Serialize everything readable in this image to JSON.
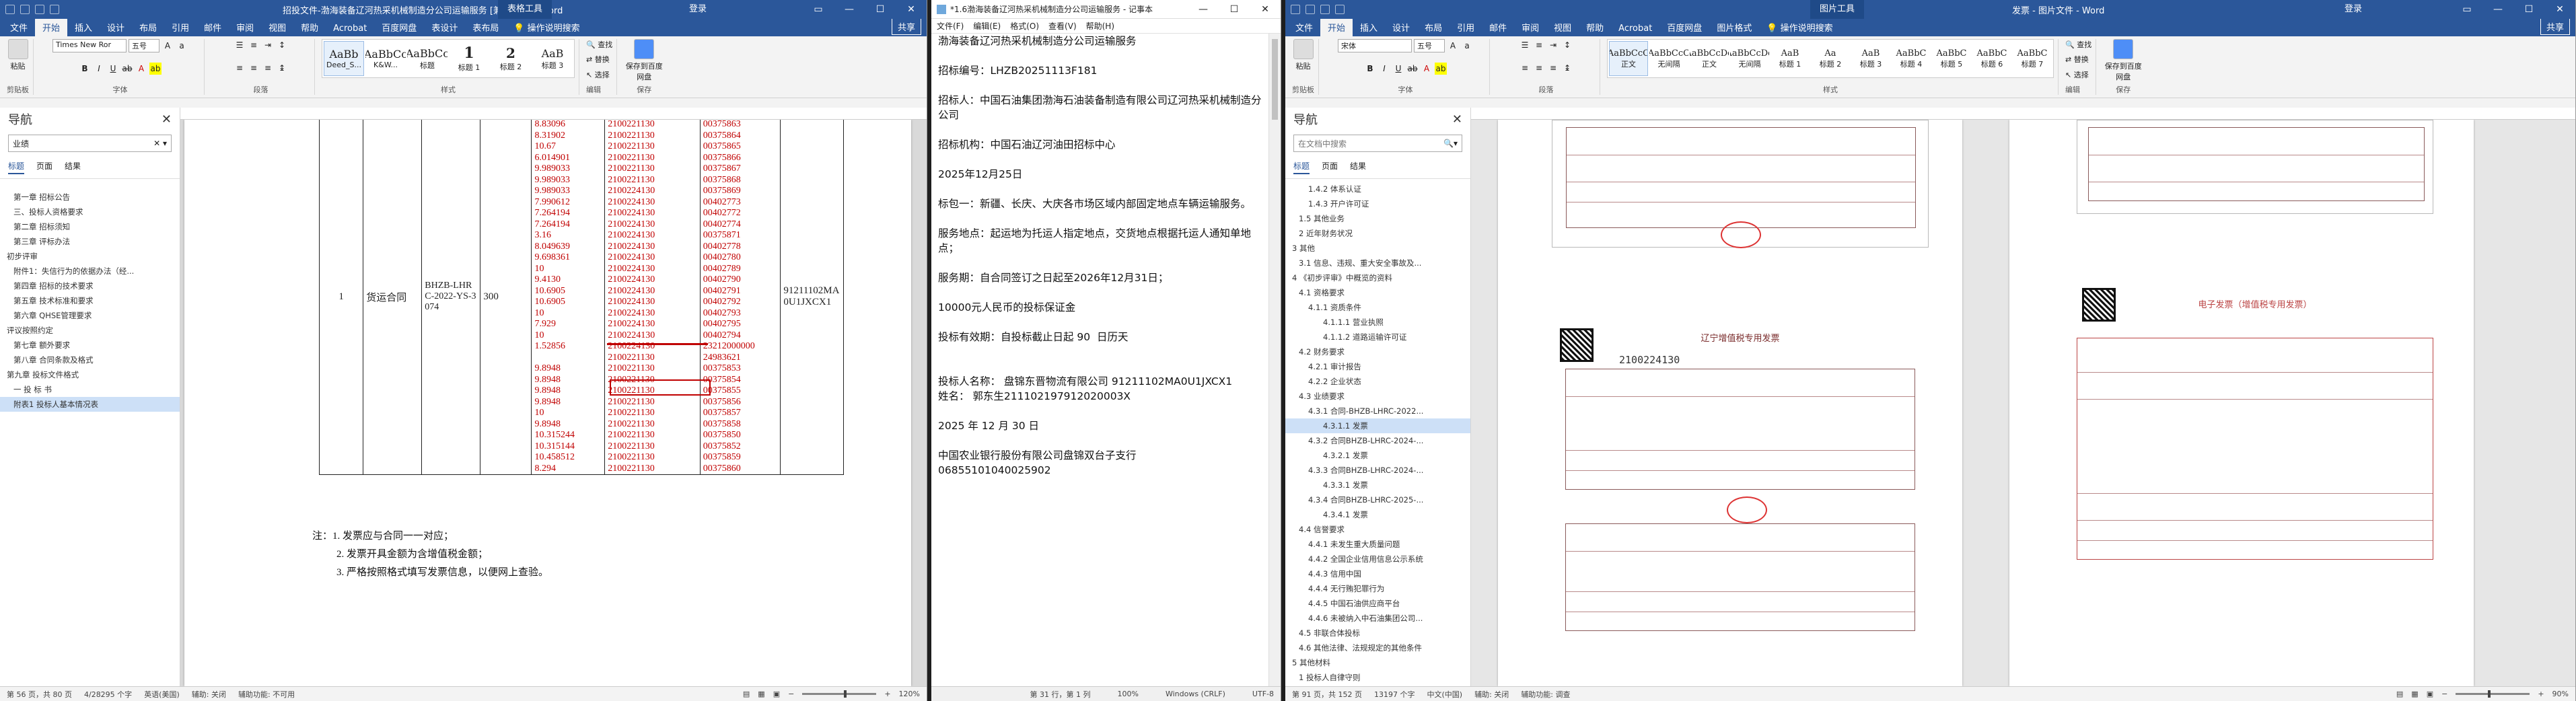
{
  "word1": {
    "title": "招投文件-渤海装备辽河热采机械制造分公司运输服务 [兼容模式] - Word",
    "context_tab": "表格工具",
    "login": "登录",
    "tabs": [
      "文件",
      "开始",
      "插入",
      "设计",
      "布局",
      "引用",
      "邮件",
      "审阅",
      "视图",
      "帮助",
      "Acrobat",
      "百度网盘",
      "表设计",
      "表布局"
    ],
    "tell_me": "操作说明搜索",
    "share": "共享",
    "ribbon": {
      "paste": "粘贴",
      "clipboard": "剪贴板",
      "font_name": "Times New Ror",
      "font_size": "五号",
      "font_group": "字体",
      "para_group": "段落",
      "styles_group": "样式",
      "edit_group": "编辑",
      "save_group": "保存",
      "find": "查找",
      "replace": "替换",
      "select": "选择",
      "save_baidu": "保存到百度网盘",
      "styles": [
        {
          "preview": "AaBb",
          "name": "Deed_S..."
        },
        {
          "preview": "AaBbCc",
          "name": "K&W..."
        },
        {
          "preview": "AaBbCc",
          "name": "标题"
        },
        {
          "preview": "1",
          "name": "标题 1"
        },
        {
          "preview": "2",
          "name": "标题 2"
        },
        {
          "preview": "AaB",
          "name": "标题 3"
        }
      ]
    },
    "nav": {
      "title": "导航",
      "search": "业绩",
      "tabs": [
        "标题",
        "页面",
        "结果"
      ],
      "items": [
        {
          "text": "第一章 招标公告",
          "level": 1
        },
        {
          "text": "三、投标人资格要求",
          "level": 1
        },
        {
          "text": "第二章 招标须知",
          "level": 1
        },
        {
          "text": "第三章 评标办法",
          "level": 1
        },
        {
          "text": "初步评审",
          "level": 0
        },
        {
          "text": "附件1：失信行为的依据办法（经...",
          "level": 1
        },
        {
          "text": "第四章 招标的技术要求",
          "level": 1
        },
        {
          "text": "第五章 技术标准和要求",
          "level": 1
        },
        {
          "text": "第六章 QHSE管理要求",
          "level": 1
        },
        {
          "text": "评议按照约定",
          "level": 0
        },
        {
          "text": "第七章 额外要求",
          "level": 1
        },
        {
          "text": "第八章 合同条款及格式",
          "level": 1
        },
        {
          "text": "第九章 投标文件格式",
          "level": 0
        },
        {
          "text": "一 投 标 书",
          "level": 1
        },
        {
          "text": "附表1 投标人基本情况表",
          "level": 1,
          "hl": true
        }
      ]
    },
    "table": {
      "seq": "1",
      "type": "货运合同",
      "contract": "BHZB-LHRC-2022-YS-3074",
      "qty": "300",
      "taxid": "91211102MA0U1JXCX1",
      "amounts": [
        "8.83096",
        "8.31902",
        "10.67",
        "6.014901",
        "9.989033",
        "9.989033",
        "9.989033",
        "7.990612",
        "7.264194",
        "7.264194",
        "3.16",
        "8.049639",
        "9.698361",
        "10",
        "9.4130",
        "10.6905",
        "10.6905",
        "10",
        "7.929",
        "10",
        "1.52856",
        "",
        "9.8948",
        "9.8948",
        "9.8948",
        "9.8948",
        "10",
        "9.8948",
        "10.315244",
        "10.315144",
        "10.458512",
        "8.294"
      ],
      "dates": [
        "2100221130",
        "2100221130",
        "2100221130",
        "2100221130",
        "2100221130",
        "2100221130",
        "2100224130",
        "2100224130",
        "2100224130",
        "2100224130",
        "2100224130",
        "2100224130",
        "2100224130",
        "2100224130",
        "2100224130",
        "2100224130",
        "2100224130",
        "2100224130",
        "2100224130",
        "2100224130",
        "2100224130",
        "2100221130",
        "2100221130",
        "2100221130",
        "2100221130",
        "2100221130",
        "2100221130",
        "2100221130",
        "2100221130",
        "2100221130",
        "2100221130",
        "2100221130"
      ],
      "codes": [
        "00375863",
        "00375864",
        "00375865",
        "00375866",
        "00375867",
        "00375868",
        "00375869",
        "00402773",
        "00402772",
        "00402774",
        "00375871",
        "00402778",
        "00402780",
        "00402789",
        "00402790",
        "00402791",
        "00402792",
        "00402793",
        "00402795",
        "00402794",
        "23212000000",
        "24983621",
        "00375853",
        "00375854",
        "00375855",
        "00375856",
        "00375857",
        "00375858",
        "00375850",
        "00375852",
        "00375859",
        "00375860"
      ]
    },
    "notes": [
      "注：1. 发票应与合同一一对应；",
      "2. 发票开具金额为含增值税金额；",
      "3. 严格按照格式填写发票信息，以便网上查验。"
    ],
    "status": {
      "page": "第 56 页，共 80 页",
      "words": "4/28295 个字",
      "lang": "英语(美国)",
      "text_pred": "辅助: 关闭",
      "access": "辅助功能: 不可用",
      "zoom": "120%"
    }
  },
  "notepad": {
    "title": "*1.6渤海装备辽河热采机械制造分公司运输服务 - 记事本",
    "menu": [
      "文件(F)",
      "编辑(E)",
      "格式(O)",
      "查看(V)",
      "帮助(H)"
    ],
    "lines": [
      "渤海装备辽河热采机械制造分公司运输服务",
      "",
      "招标编号：LHZB20251113F181",
      "",
      "招标人：中国石油集团渤海石油装备制造有限公司辽河热采机械制造分公司",
      "",
      "招标机构：中国石油辽河油田招标中心",
      "",
      "2025年12月25日",
      "",
      "标包一：新疆、长庆、大庆各市场区域内部固定地点车辆运输服务。",
      "",
      "服务地点：起运地为托运人指定地点，交货地点根据托运人通知单地点；",
      "",
      "服务期：自合同签订之日起至2026年12月31日；",
      "",
      "10000元人民币的投标保证金",
      "",
      "投标有效期：自投标截止日起 90  日历天",
      "",
      "",
      "投标人名称： 盘锦东晋物流有限公司 91211102MA0U1JXCX1",
      "姓名： 郭东生211102197912020003X",
      "",
      "2025 年 12 月 30 日",
      "",
      "中国农业银行股份有限公司盘锦双台子支行",
      "06855101040025902"
    ],
    "status": {
      "pos": "第 31 行，第 1 列",
      "zoom": "100%",
      "eol": "Windows (CRLF)",
      "enc": "UTF-8"
    }
  },
  "word2": {
    "title": "发票 - 图片文件 - Word",
    "doc_title": "图片工具",
    "login": "登录",
    "tabs": [
      "文件",
      "开始",
      "插入",
      "设计",
      "布局",
      "引用",
      "邮件",
      "审阅",
      "视图",
      "帮助",
      "Acrobat",
      "百度网盘",
      "图片格式"
    ],
    "tell_me": "操作说明搜索",
    "share": "共享",
    "ribbon": {
      "paste": "粘贴",
      "clipboard": "剪贴板",
      "font_name": "宋体",
      "font_size": "五号",
      "font_group": "字体",
      "para_group": "段落",
      "styles_group": "样式",
      "edit_group": "编辑",
      "save_group": "保存",
      "find": "查找",
      "replace": "替换",
      "select": "选择",
      "save_baidu": "保存到百度网盘",
      "styles": [
        {
          "preview": "AaBbCcC",
          "name": "正文"
        },
        {
          "preview": "AaBbCcC",
          "name": "无间隔"
        },
        {
          "preview": "AaBbCcDd",
          "name": "正文"
        },
        {
          "preview": "AaBbCcDd",
          "name": "无间隔"
        },
        {
          "preview": "AaB",
          "name": "标题 1"
        },
        {
          "preview": "Aa",
          "name": "标题 2"
        },
        {
          "preview": "AaB",
          "name": "标题 3"
        },
        {
          "preview": "AaBbC",
          "name": "标题 4"
        },
        {
          "preview": "AaBbC",
          "name": "标题 5"
        },
        {
          "preview": "AaBbC",
          "name": "标题 6"
        },
        {
          "preview": "AaBbC",
          "name": "标题 7"
        }
      ]
    },
    "nav": {
      "title": "导航",
      "search": "在文档中搜索",
      "tabs": [
        "标题",
        "页面",
        "结果"
      ],
      "items": [
        {
          "text": "1.4.2 体系认证",
          "level": 2
        },
        {
          "text": "1.4.3 开户许可证",
          "level": 2
        },
        {
          "text": "1.5 其他业务",
          "level": 1
        },
        {
          "text": "2 近年财务状况",
          "level": 1
        },
        {
          "text": "3 其他",
          "level": 0
        },
        {
          "text": "3.1 信息、违规、重大安全事故及...",
          "level": 1
        },
        {
          "text": "4 《初步评审》中概览的资料",
          "level": 0
        },
        {
          "text": "4.1 资格要求",
          "level": 1
        },
        {
          "text": "4.1.1 资质条件",
          "level": 2
        },
        {
          "text": "4.1.1.1 营业执照",
          "level": 3
        },
        {
          "text": "4.1.1.2 道路运输许可证",
          "level": 3
        },
        {
          "text": "4.2 财务要求",
          "level": 1
        },
        {
          "text": "4.2.1 审计报告",
          "level": 2
        },
        {
          "text": "4.2.2 企业状态",
          "level": 2
        },
        {
          "text": "4.3 业绩要求",
          "level": 1
        },
        {
          "text": "4.3.1 合同-BHZB-LHRC-2022...",
          "level": 2
        },
        {
          "text": "4.3.1.1 发票",
          "level": 3,
          "hl": true
        },
        {
          "text": "4.3.2 合同BHZB-LHRC-2024-...",
          "level": 2
        },
        {
          "text": "4.3.2.1 发票",
          "level": 3
        },
        {
          "text": "4.3.3 合同BHZB-LHRC-2024-...",
          "level": 2
        },
        {
          "text": "4.3.3.1 发票",
          "level": 3
        },
        {
          "text": "4.3.4 合同BHZB-LHRC-2025-...",
          "level": 2
        },
        {
          "text": "4.3.4.1 发票",
          "level": 3
        },
        {
          "text": "4.4 信誉要求",
          "level": 1
        },
        {
          "text": "4.4.1 未发生重大质量问题",
          "level": 2
        },
        {
          "text": "4.4.2 全国企业信用信息公示系统",
          "level": 2
        },
        {
          "text": "4.4.3 信用中国",
          "level": 2
        },
        {
          "text": "4.4.4 无行贿犯罪行为",
          "level": 2
        },
        {
          "text": "4.4.5 中国石油供应商平台",
          "level": 2
        },
        {
          "text": "4.4.6 未被纳入中石油集团公司...",
          "level": 2
        },
        {
          "text": "4.5 非联合体投标",
          "level": 1
        },
        {
          "text": "4.6 其他法律、法规规定的其他条件",
          "level": 1
        },
        {
          "text": "5 其他材料",
          "level": 0
        },
        {
          "text": "1 投标人自律守则",
          "level": 1
        }
      ]
    },
    "invoices": [
      {
        "number": "",
        "title": ""
      },
      {
        "number": "",
        "title": ""
      },
      {
        "number": "2100224130",
        "title": "辽宁增值税专用发票"
      },
      {
        "number": "",
        "title": "电子发票（增值税专用发票）"
      }
    ],
    "status": {
      "page": "第 91 页，共 152 页",
      "words": "13197 个字",
      "lang": "中文(中国)",
      "text_pred": "辅助: 关闭",
      "access": "辅助功能: 调查",
      "zoom": "90%"
    }
  }
}
